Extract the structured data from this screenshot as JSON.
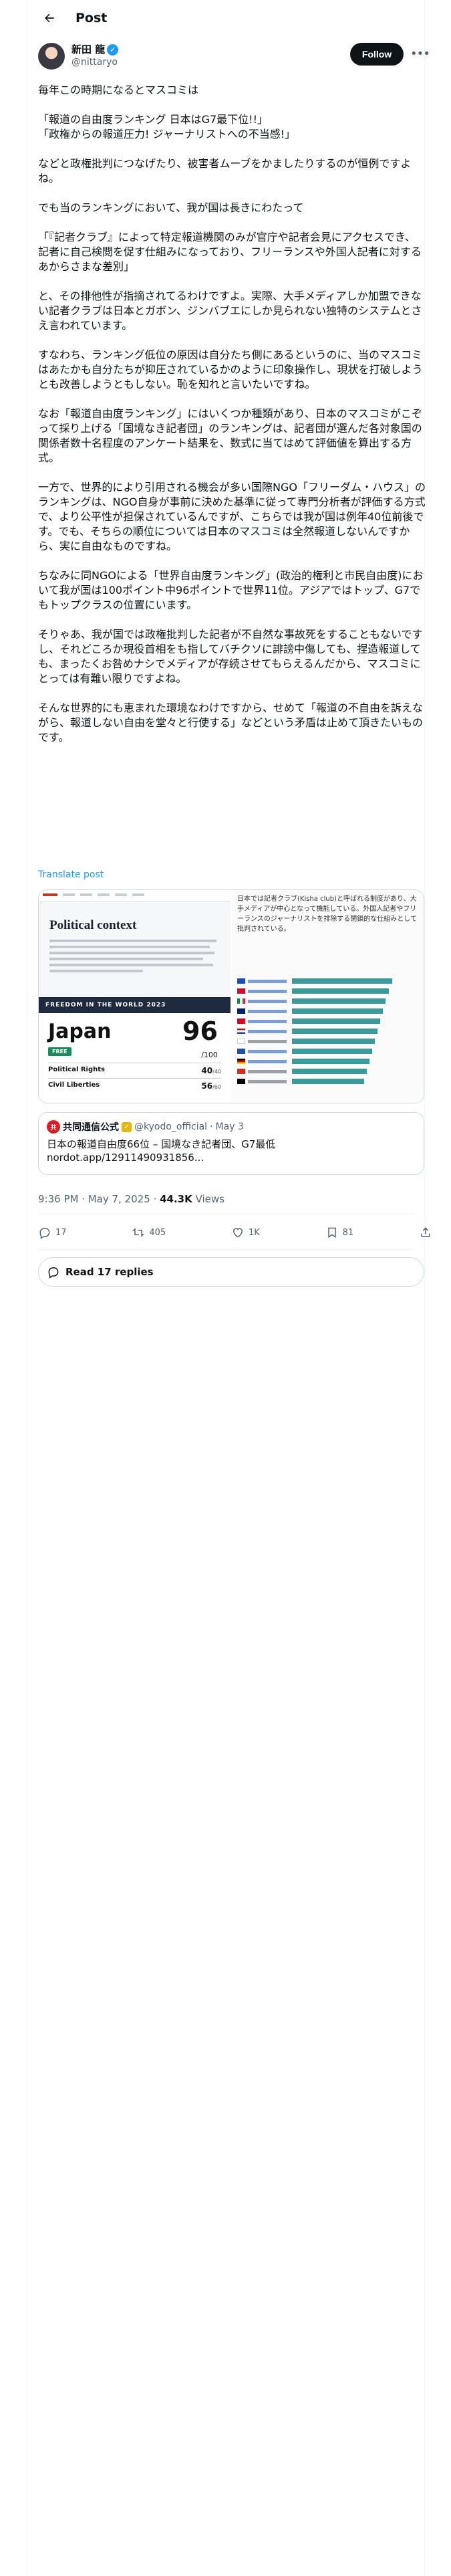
{
  "header": {
    "title": "Post"
  },
  "author": {
    "display_name": "新田 龍",
    "handle": "@nittaryo",
    "follow_label": "Follow"
  },
  "post": {
    "paragraphs": [
      "毎年この時期になるとマスコミは",
      "「報道の自由度ランキング 日本はG7最下位!!」\n「政権からの報道圧力! ジャーナリストへの不当感!」",
      "などと政権批判につなげたり、被害者ムーブをかましたりするのが恒例ですよね。",
      "でも当のランキングにおいて、我が国は長きにわたって",
      "「『記者クラブ』によって特定報道機関のみが官庁や記者会見にアクセスでき、記者に自己検閲を促す仕組みになっており、フリーランスや外国人記者に対するあからさまな差別」",
      "と、その排他性が指摘されてるわけですよ。実際、大手メディアしか加盟できない記者クラブは日本とガボン、ジンバブエにしか見られない独特のシステムとさえ言われています。",
      "すなわち、ランキング低位の原因は自分たち側にあるというのに、当のマスコミはあたかも自分たちが抑圧されているかのように印象操作し、現状を打破しようとも改善しようともしない。恥を知れと言いたいですね。",
      "なお「報道自由度ランキング」にはいくつか種類があり、日本のマスコミがこぞって採り上げる「国境なき記者団」のランキングは、記者団が選んだ各対象国の関係者数十名程度のアンケート結果を、数式に当てはめて評価値を算出する方式。",
      "一方で、世界的により引用される機会が多い国際NGO「フリーダム・ハウス」のランキングは、NGO自身が事前に決めた基準に従って専門分析者が評価する方式で、より公平性が担保されているんですが、こちらでは我が国は例年40位前後です。でも、そちらの順位については日本のマスコミは全然報道しないんですから、実に自由なものですね。",
      "ちなみに同NGOによる「世界自由度ランキング」(政治的権利と市民自由度)において我が国は100ポイント中96ポイントで世界11位。アジアではトップ、G7でもトップクラスの位置にいます。",
      "そりゃあ、我が国では政権批判した記者が不自然な事故死をすることもないですし、それどころか現役首相をも指してバチクソに誹謗中傷しても、捏造報道しても、まったくお咎めナシでメディアが存続させてもらえるんだから、マスコミにとっては有難い限りですよね。",
      "そんな世界的にも恵まれた環境なわけですから、せめて「報道の不自由を訴えながら、報道しない自由を堂々と行使する」などという矛盾は止めて頂きたいものです。"
    ],
    "translate_label": "Translate post"
  },
  "media": {
    "left": {
      "section_title": "Political context",
      "banner": "FREEDOM IN THE WORLD 2023",
      "country": "Japan",
      "status": "FREE",
      "score": "96",
      "score_total": "/100",
      "rows": [
        {
          "label": "Political Rights",
          "value": "40",
          "total": "/40"
        },
        {
          "label": "Civil Liberties",
          "value": "56",
          "total": "/60"
        }
      ]
    },
    "right": {
      "snippet": "日本では記者クラブ(Kisha club)と呼ばれる制度があり、大手メディアが中心となって機能している。外国人記者やフリーランスのジャーナリストを排除する閉鎖的な仕組みとして批判されている。"
    }
  },
  "quote": {
    "name": "共同通信公式",
    "handle": "@kyodo_official",
    "date": "May 3",
    "text": "日本の報道自由度66位 – 国境なき記者団、G7最低\nnordot.app/12911490931856..."
  },
  "meta": {
    "time": "9:36 PM · May 7, 2025",
    "views": "44.3K",
    "views_label": "Views"
  },
  "actions": {
    "replies": "17",
    "reposts": "405",
    "likes": "1K",
    "bookmarks": "81"
  },
  "read_replies": "Read 17 replies"
}
